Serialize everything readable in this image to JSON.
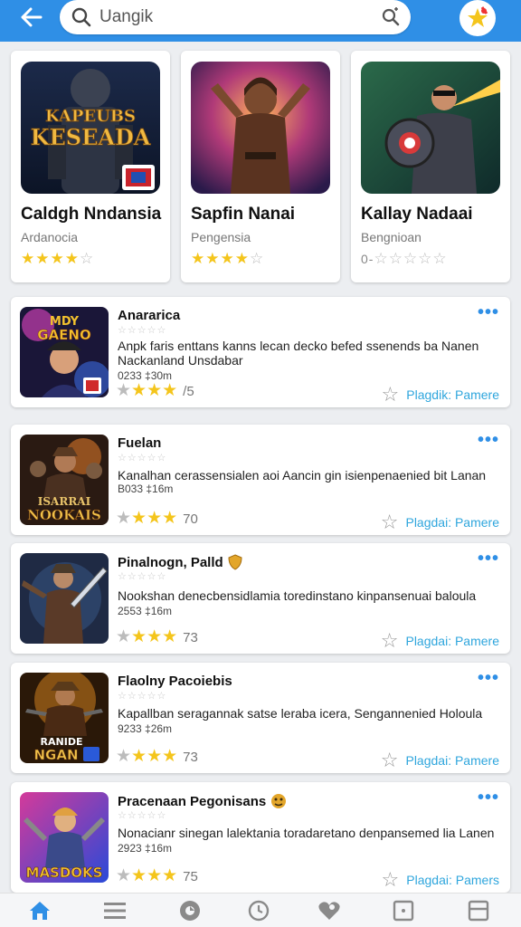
{
  "search": {
    "value": "Uangik"
  },
  "featured": [
    {
      "title": "Caldgh Nndansia",
      "subtitle": "Ardanocia",
      "rating": 4,
      "art_text": "KAPEUBS KESEADA"
    },
    {
      "title": "Sapfin Nanai",
      "subtitle": "Pengensia",
      "rating": 4,
      "prefix": ""
    },
    {
      "title": "Kallay Nadaai",
      "subtitle": "Bengnioan",
      "rating": 0,
      "prefix": "0-"
    }
  ],
  "list": [
    {
      "title": "Anararica",
      "desc": "Anpk faris enttans kanns lecan  decko befed ssenends ba Nanen",
      "desc2": "Nackanland Unsdabar",
      "meta": "0233 ‡30m",
      "rating_label": "/5",
      "action": "Plagdik: Pamere",
      "art_text": "MDY GAENO",
      "badge": ""
    },
    {
      "title": "Fuelan",
      "desc": "Kanalhan cerassensialen aoi Aancin gin isienpenaenied bit Lanan",
      "desc2": "",
      "meta": "B033 ‡16m",
      "rating_label": "70",
      "action": "Plagdai: Pamere",
      "art_text": "NOOKAIS",
      "badge": ""
    },
    {
      "title": "Pinalnogn, Palld",
      "desc": "Nookshan denecbensidlamia toredinstano kinpansenuai baloula",
      "desc2": "",
      "meta": "2553 ‡16m",
      "rating_label": "73",
      "action": "Plagdai: Pamere",
      "art_text": "",
      "badge": "shield"
    },
    {
      "title": "Flaolny  Pacoiebis",
      "desc": "Kapallban seragannak satse leraba icera, Sengannenied Holoula",
      "desc2": "",
      "meta": "9233 ‡26m",
      "rating_label": "73",
      "action": "Plagdai: Pamere",
      "art_text": "NGAN",
      "badge": ""
    },
    {
      "title": "Pracenaan Pegonisans",
      "desc": "Nonacianr sinegan lalektania toradaretano denpansemed lia Lanen",
      "desc2": "",
      "meta": "2923 ‡16m",
      "rating_label": "75",
      "action": "Plagdai: Pamers",
      "art_text": "MASDOKS",
      "badge": "face"
    }
  ],
  "colors": {
    "accent": "#2f8fe6",
    "star": "#f4c51c",
    "link": "#2fa6dd"
  }
}
